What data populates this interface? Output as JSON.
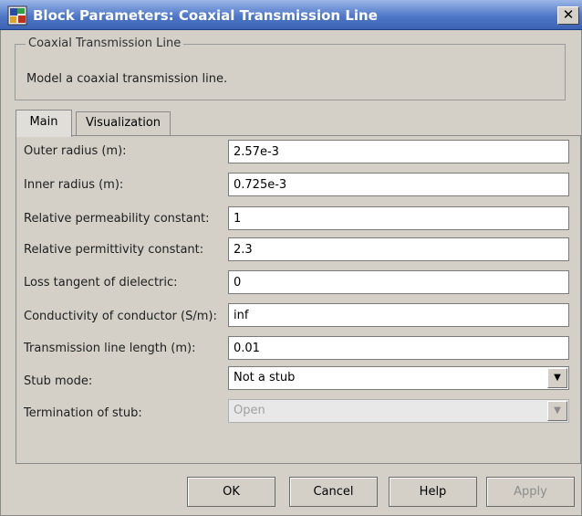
{
  "window": {
    "title": "Block Parameters: Coaxial Transmission Line"
  },
  "description": {
    "legend": "Coaxial Transmission Line",
    "text": "Model a coaxial transmission line."
  },
  "tabs": [
    {
      "label": "Main",
      "active": true
    },
    {
      "label": "Visualization",
      "active": false
    }
  ],
  "params": {
    "outer_radius": {
      "label": "Outer radius (m):",
      "value": "2.57e-3"
    },
    "inner_radius": {
      "label": "Inner radius (m):",
      "value": "0.725e-3"
    },
    "permeability": {
      "label": "Relative permeability constant:",
      "value": "1"
    },
    "permittivity": {
      "label": "Relative permittivity constant:",
      "value": "2.3"
    },
    "loss_tangent": {
      "label": "Loss tangent of dielectric:",
      "value": "0"
    },
    "conductivity": {
      "label": "Conductivity of conductor (S/m):",
      "value": "inf"
    },
    "line_length": {
      "label": "Transmission line length (m):",
      "value": "0.01"
    },
    "stub_mode": {
      "label": "Stub mode:",
      "value": "Not a stub"
    },
    "stub_termination": {
      "label": "Termination of stub:",
      "value": "Open",
      "enabled": false
    }
  },
  "buttons": {
    "ok": "OK",
    "cancel": "Cancel",
    "help": "Help",
    "apply": "Apply"
  },
  "colors": {
    "dialog_bg": "#d4d0c8",
    "titlebar": "#4f78c8",
    "title_text": "#ffffff",
    "disabled_text": "#a0a0a0"
  },
  "icons": {
    "title": "block-parameters-icon",
    "close": "close-icon",
    "dropdown": "chevron-down-icon"
  }
}
